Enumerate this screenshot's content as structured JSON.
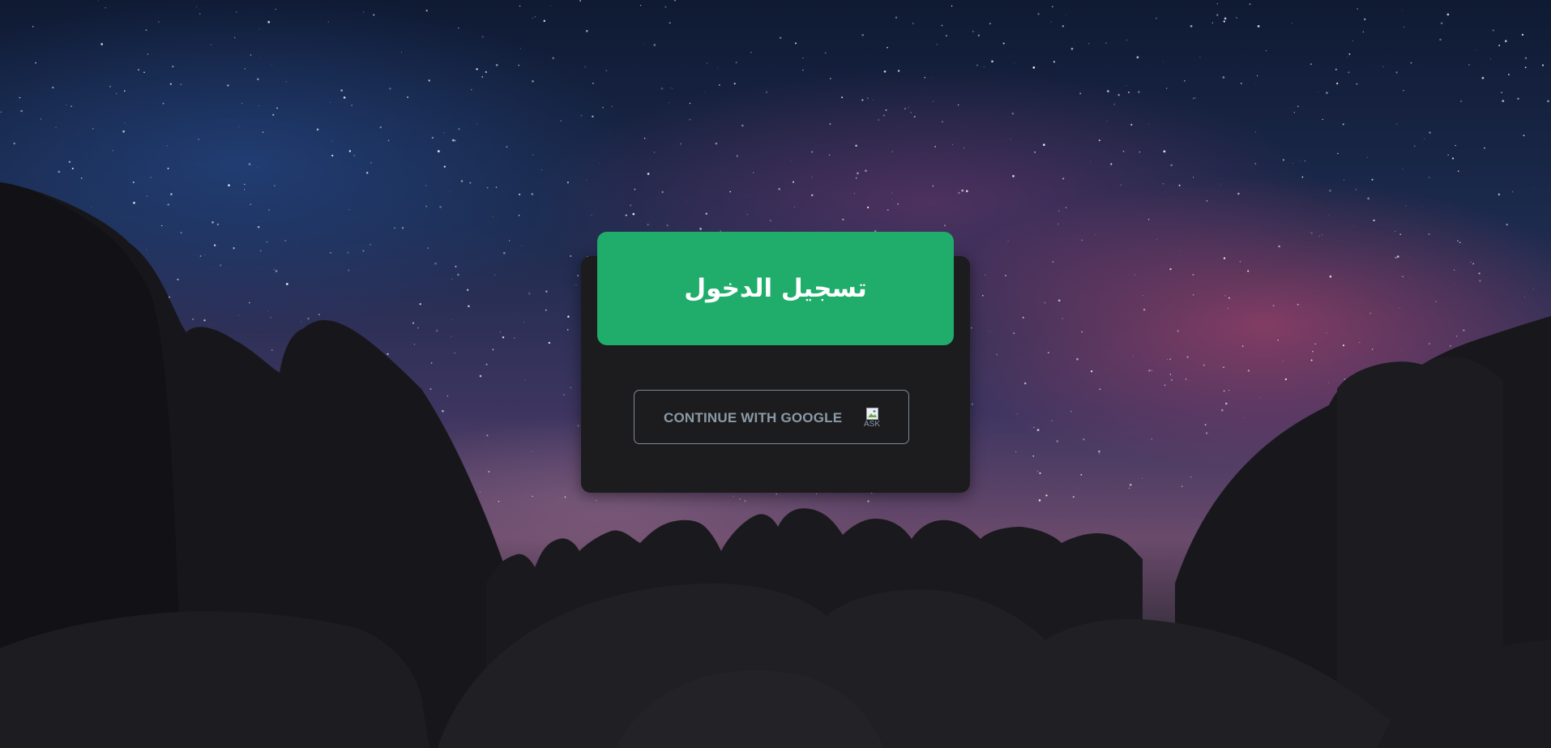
{
  "login": {
    "title": "تسجيل الدخول",
    "google_button_label": "CONTINUE WITH GOOGLE",
    "google_icon_alt": "ASK"
  },
  "colors": {
    "header_green": "#20ad6c",
    "card_background": "#1c1c1e",
    "button_border": "#7c8a94",
    "button_text": "#8a9aa6"
  },
  "icons": {
    "google_logo": "broken-image-icon"
  }
}
